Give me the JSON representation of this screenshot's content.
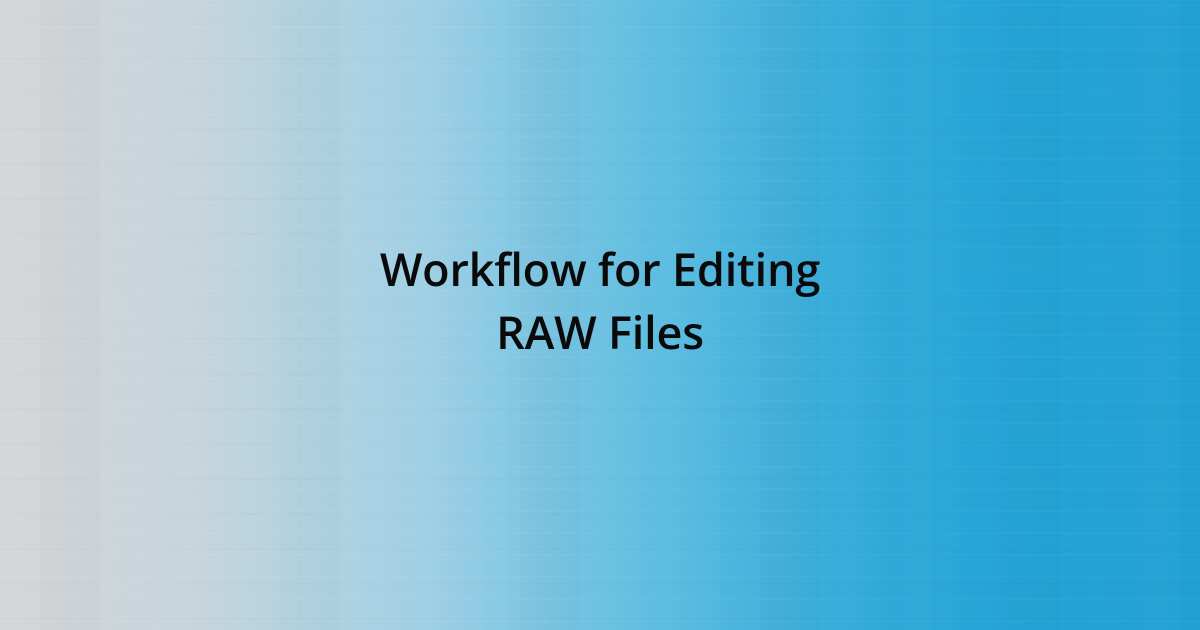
{
  "title": {
    "line1": "Workflow for Editing",
    "line2": "RAW Files"
  }
}
